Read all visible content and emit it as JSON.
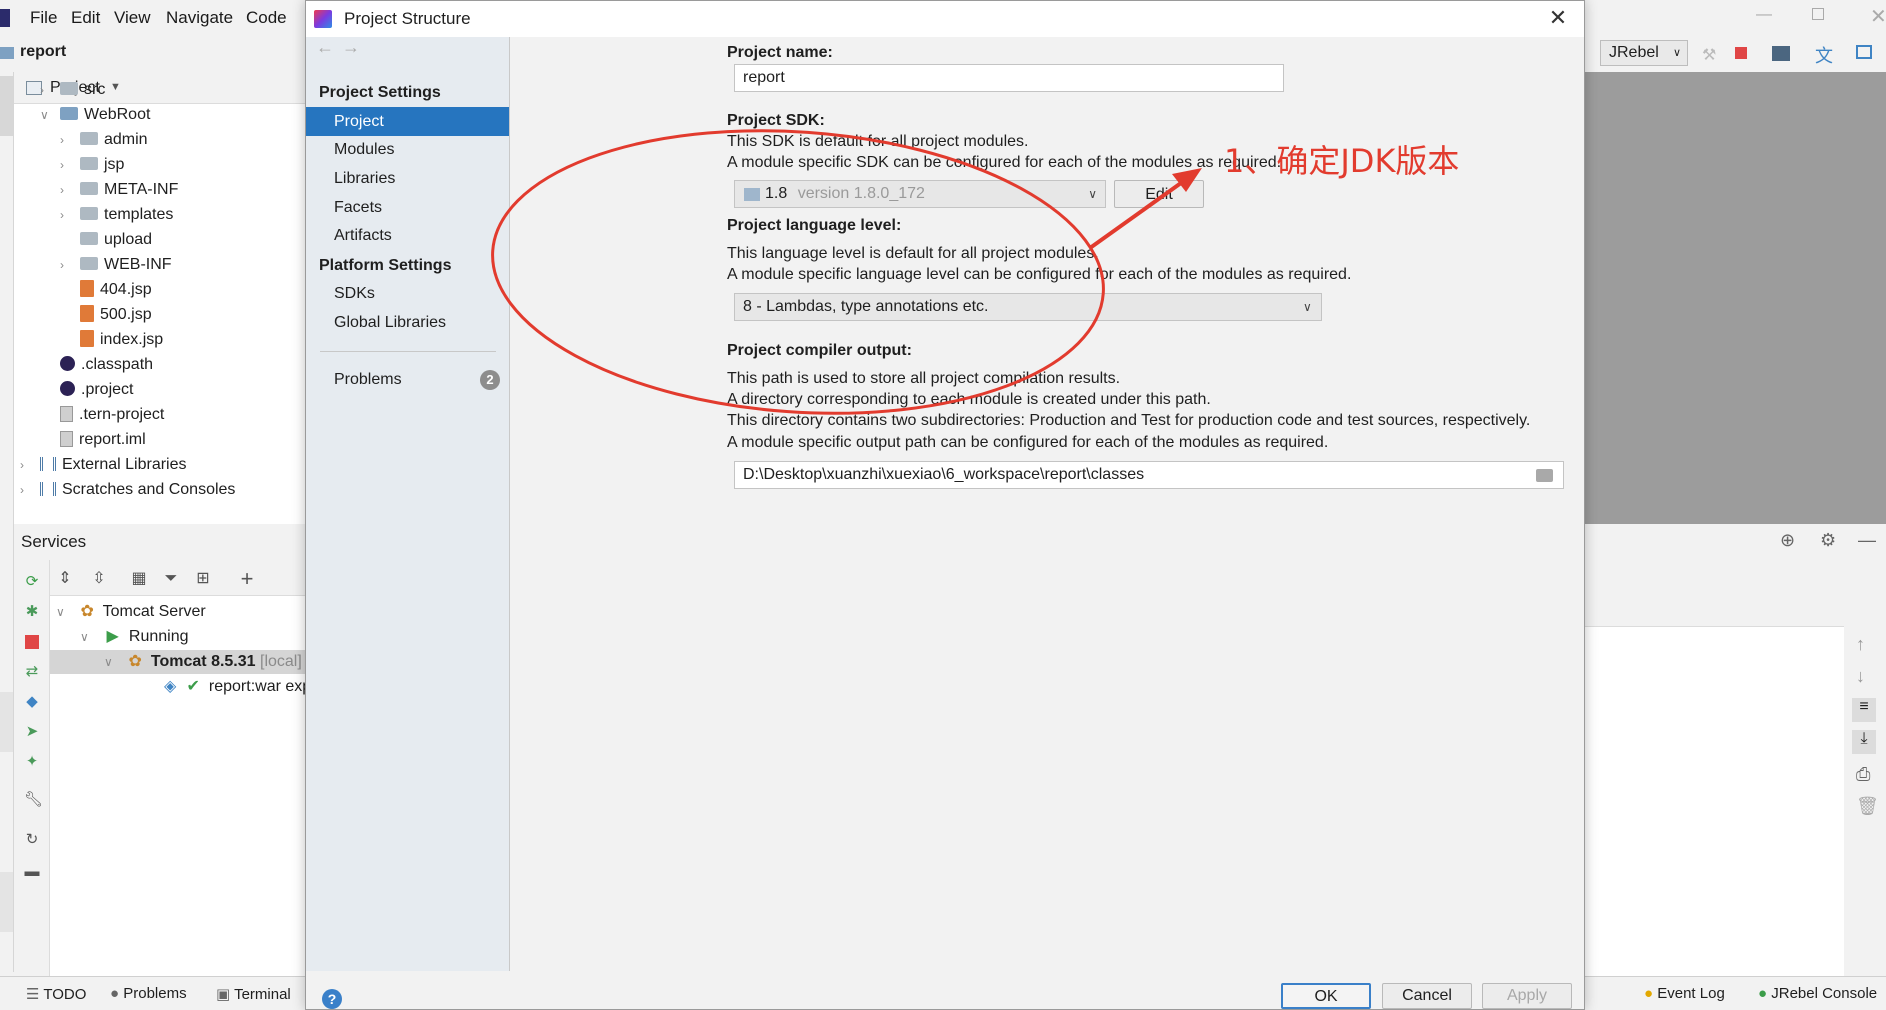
{
  "menubar": {
    "items": [
      "File",
      "Edit",
      "View",
      "Navigate",
      "Code"
    ]
  },
  "nav": {
    "project": "report"
  },
  "project_panel": {
    "title": "Project",
    "tree": [
      {
        "label": "src",
        "indent": 1,
        "icon": "folder",
        "fold": "right"
      },
      {
        "label": "WebRoot",
        "indent": 1,
        "icon": "web-folder",
        "fold": "down"
      },
      {
        "label": "admin",
        "indent": 2,
        "icon": "folder",
        "fold": "right"
      },
      {
        "label": "jsp",
        "indent": 2,
        "icon": "folder",
        "fold": "right"
      },
      {
        "label": "META-INF",
        "indent": 2,
        "icon": "folder",
        "fold": "right"
      },
      {
        "label": "templates",
        "indent": 2,
        "icon": "folder",
        "fold": "right"
      },
      {
        "label": "upload",
        "indent": 2,
        "icon": "folder",
        "fold": ""
      },
      {
        "label": "WEB-INF",
        "indent": 2,
        "icon": "folder",
        "fold": "right"
      },
      {
        "label": "404.jsp",
        "indent": 2,
        "icon": "jsp",
        "fold": ""
      },
      {
        "label": "500.jsp",
        "indent": 2,
        "icon": "jsp",
        "fold": ""
      },
      {
        "label": "index.jsp",
        "indent": 2,
        "icon": "jsp",
        "fold": ""
      },
      {
        "label": ".classpath",
        "indent": 1,
        "icon": "eclipse",
        "fold": ""
      },
      {
        "label": ".project",
        "indent": 1,
        "icon": "eclipse",
        "fold": ""
      },
      {
        "label": ".tern-project",
        "indent": 1,
        "icon": "file",
        "fold": ""
      },
      {
        "label": "report.iml",
        "indent": 1,
        "icon": "file",
        "fold": ""
      },
      {
        "label": "External Libraries",
        "indent": 0,
        "icon": "lib",
        "fold": "right"
      },
      {
        "label": "Scratches and Consoles",
        "indent": 0,
        "icon": "scratch",
        "fold": "right"
      }
    ]
  },
  "services": {
    "title": "Services",
    "tree": {
      "tomcat_server": "Tomcat Server",
      "running": "Running",
      "tomcat_instance": "Tomcat 8.5.31",
      "local_tag": "[local]",
      "artifact": "report:war expl"
    }
  },
  "right_toolbar": {
    "jrebel": "JRebel"
  },
  "bottom_bar": {
    "todo": "TODO",
    "problems": "Problems",
    "terminal": "Terminal",
    "event_log": "Event Log",
    "jrebel_console": "JRebel Console"
  },
  "dialog": {
    "title": "Project Structure",
    "sidebar": {
      "project_settings_header": "Project Settings",
      "project_settings_items": [
        "Project",
        "Modules",
        "Libraries",
        "Facets",
        "Artifacts"
      ],
      "selected": "Project",
      "platform_settings_header": "Platform Settings",
      "platform_settings_items": [
        "SDKs",
        "Global Libraries"
      ],
      "problems_label": "Problems",
      "problems_count": "2"
    },
    "content": {
      "project_name_label": "Project name:",
      "project_name_value": "report",
      "sdk_label": "Project SDK:",
      "sdk_desc1": "This SDK is default for all project modules.",
      "sdk_desc2": "A module specific SDK can be configured for each of the modules as required.",
      "sdk_version_main": "1.8",
      "sdk_version_detail": "version 1.8.0_172",
      "edit_button": "Edit",
      "lang_label": "Project language level:",
      "lang_desc1": "This language level is default for all project modules.",
      "lang_desc2": "A module specific language level can be configured for each of the modules as required.",
      "lang_value": "8 - Lambdas, type annotations etc.",
      "compiler_label": "Project compiler output:",
      "compiler_desc1": "This path is used to store all project compilation results.",
      "compiler_desc2": "A directory corresponding to each module is created under this path.",
      "compiler_desc3": "This directory contains two subdirectories: Production and Test for production code and test sources, respectively.",
      "compiler_desc4": "A module specific output path can be configured for each of the modules as required.",
      "compiler_path": "D:\\Desktop\\xuanzhi\\xuexiao\\6_workspace\\report\\classes"
    },
    "buttons": {
      "ok": "OK",
      "cancel": "Cancel",
      "apply": "Apply"
    }
  },
  "annotation": {
    "text": "1、确定JDK版本",
    "color": "#e23b2e"
  }
}
